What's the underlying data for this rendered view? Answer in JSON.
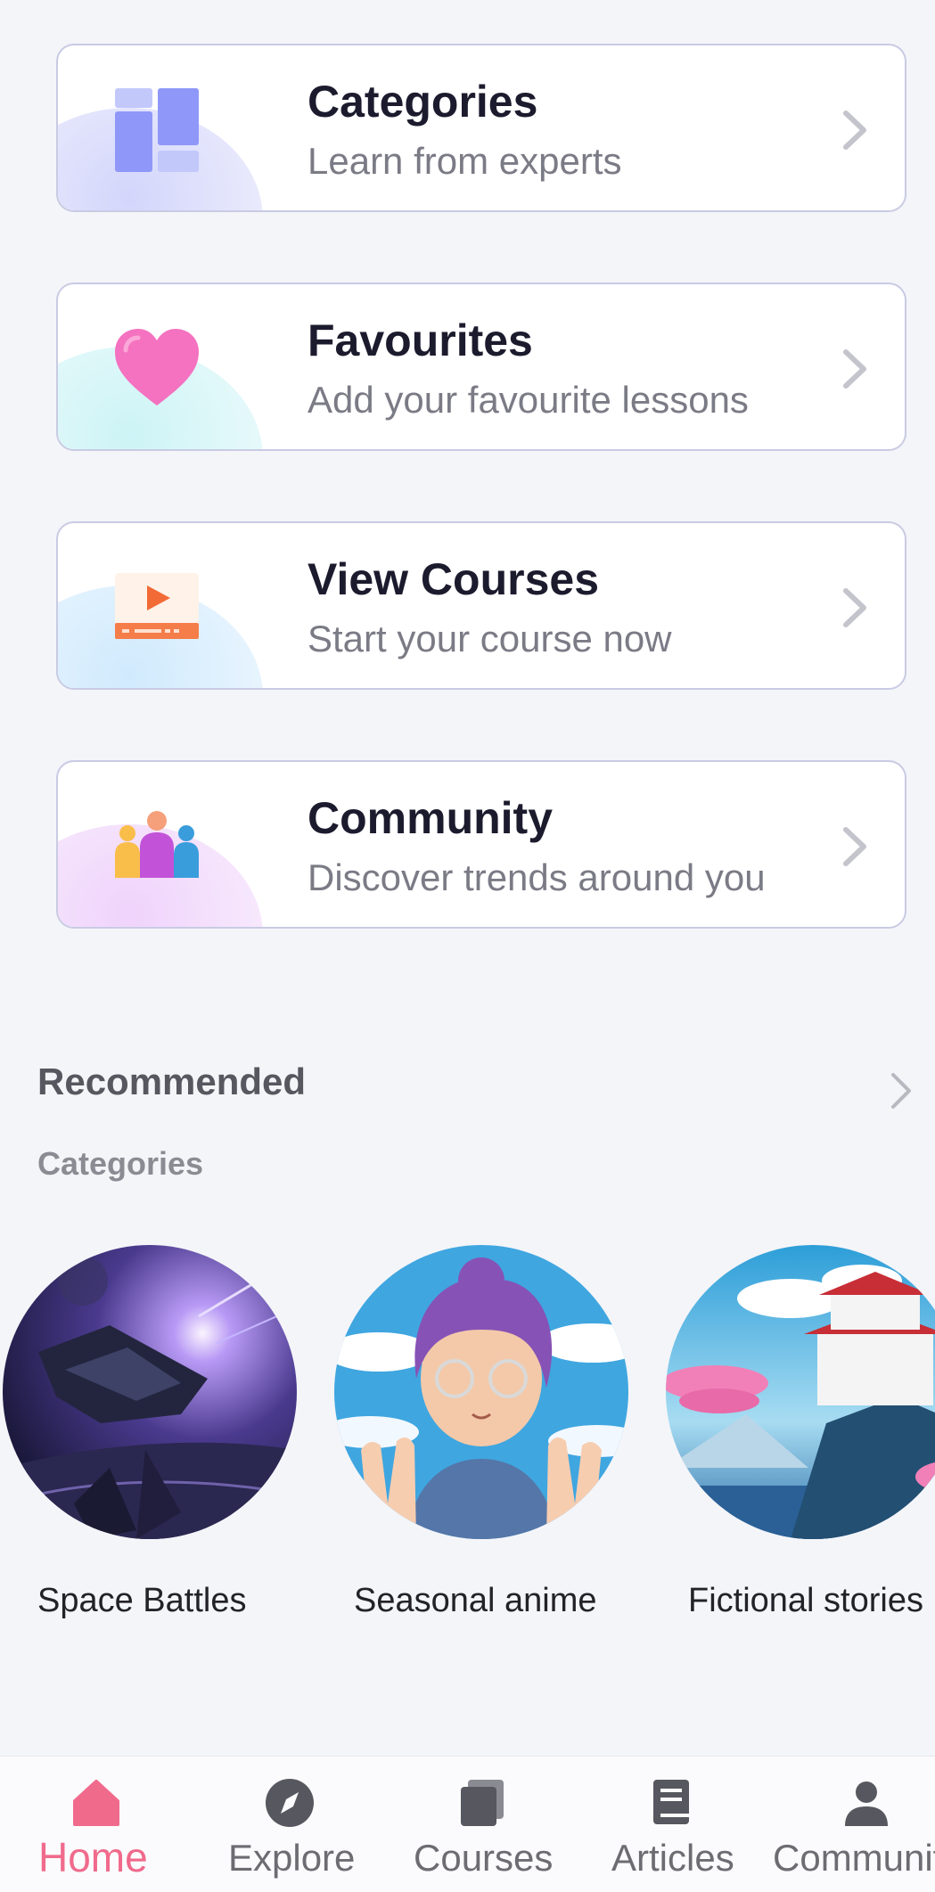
{
  "menu": [
    {
      "title": "Categories",
      "subtitle": "Learn from experts",
      "icon": "grid-icon",
      "blob": "#d9dcfb"
    },
    {
      "title": "Favourites",
      "subtitle": "Add your favourite lessons",
      "icon": "heart-icon",
      "blob": "#d5f6f7"
    },
    {
      "title": "View Courses",
      "subtitle": "Start your course now",
      "icon": "video-icon",
      "blob": "#d7eefd"
    },
    {
      "title": "Community",
      "subtitle": "Discover trends around you",
      "icon": "people-icon",
      "blob": "#f3dcfa"
    }
  ],
  "recommended": {
    "title": "Recommended",
    "subtitle": "Categories",
    "items": [
      {
        "label": "Space Battles"
      },
      {
        "label": "Seasonal anime"
      },
      {
        "label": "Fictional stories"
      }
    ]
  },
  "nav": {
    "items": [
      {
        "label": "Home",
        "icon": "home-icon",
        "active": true
      },
      {
        "label": "Explore",
        "icon": "compass-icon"
      },
      {
        "label": "Courses",
        "icon": "courses-icon"
      },
      {
        "label": "Articles",
        "icon": "articles-icon"
      },
      {
        "label": "Community",
        "icon": "person-icon"
      }
    ]
  },
  "colors": {
    "accent": "#f06a8c",
    "background": "#f4f5f9",
    "title": "#1c1b2e",
    "subtitle": "#7b7b86"
  }
}
